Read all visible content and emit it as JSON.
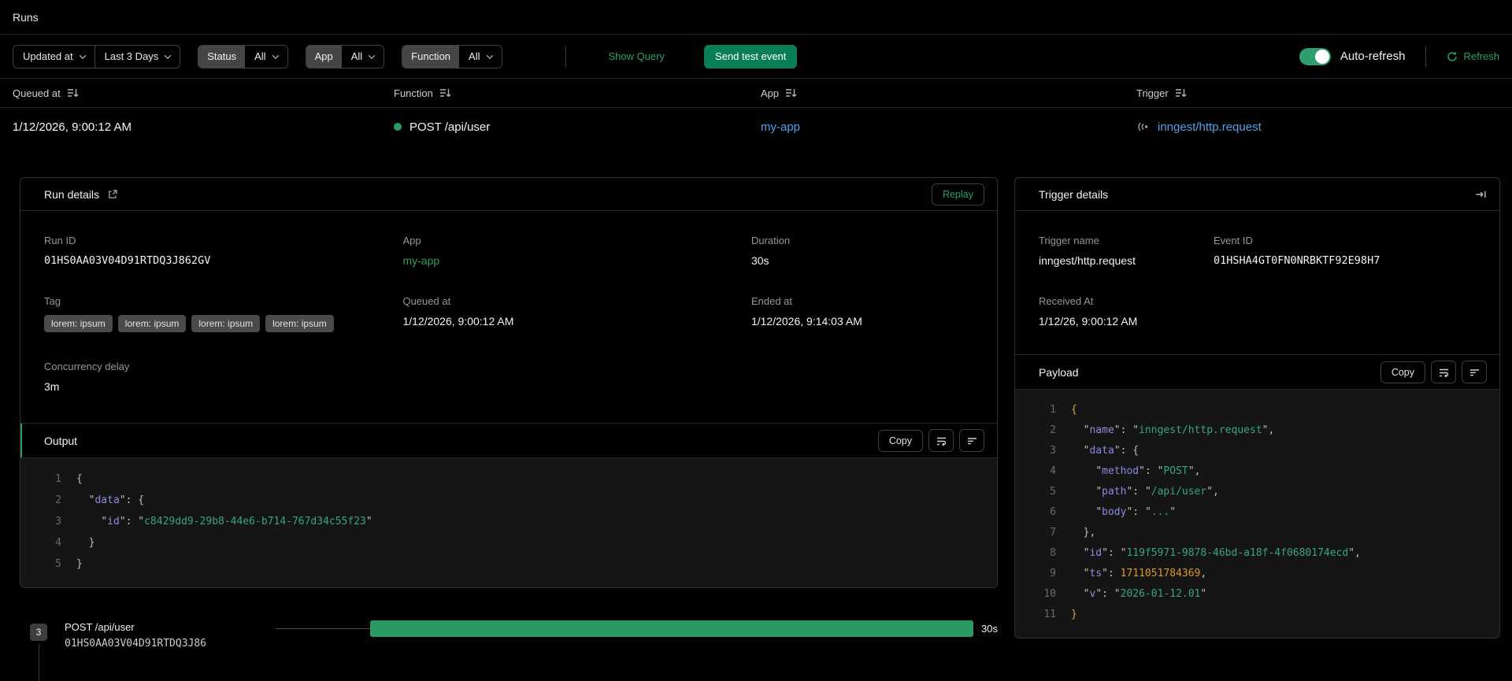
{
  "page": {
    "title": "Runs"
  },
  "colors": {
    "accent_green": "#2c9b63",
    "button_green": "#0a7e57",
    "link_blue": "#53a0e4"
  },
  "icons": [
    "sort-icon",
    "chevron-down-icon",
    "refresh-icon",
    "external-link-icon",
    "word-wrap-icon",
    "align-left-icon",
    "collapse-panel-icon",
    "webhook-icon",
    "status-dot"
  ],
  "filters": {
    "field_selector": {
      "value": "Updated at"
    },
    "range_selector": {
      "value": "Last 3 Days"
    },
    "status_filter": {
      "label": "Status",
      "value": "All"
    },
    "app_filter": {
      "label": "App",
      "value": "All"
    },
    "function_filter": {
      "label": "Function",
      "value": "All"
    },
    "show_query": "Show Query",
    "send_test_event": "Send test event",
    "auto_refresh": {
      "label": "Auto-refresh",
      "enabled": true
    },
    "refresh": "Refresh"
  },
  "table": {
    "headers": [
      {
        "label": "Queued at"
      },
      {
        "label": "Function"
      },
      {
        "label": "App"
      },
      {
        "label": "Trigger"
      }
    ],
    "row": {
      "queued_at": "1/12/2026, 9:00:12 AM",
      "function": "POST /api/user",
      "app": "my-app",
      "trigger": "inngest/http.request"
    }
  },
  "run_details": {
    "title": "Run details",
    "replay": "Replay",
    "run_id": {
      "label": "Run ID",
      "value": "01HS0AA03V04D91RTDQ3J862GV"
    },
    "app": {
      "label": "App",
      "value": "my-app"
    },
    "duration": {
      "label": "Duration",
      "value": "30s"
    },
    "tag": {
      "label": "Tag",
      "pills": [
        "lorem: ipsum",
        "lorem: ipsum",
        "lorem: ipsum",
        "lorem: ipsum"
      ]
    },
    "queued_at": {
      "label": "Queued at",
      "value": "1/12/2026, 9:00:12 AM"
    },
    "ended_at": {
      "label": "Ended at",
      "value": "1/12/2026, 9:14:03 AM"
    },
    "concurrency_delay": {
      "label": "Concurrency delay",
      "value": "3m"
    },
    "output": {
      "title": "Output",
      "copy": "Copy",
      "lines": [
        {
          "n": 1,
          "t": [
            [
              "{",
              "p"
            ]
          ]
        },
        {
          "n": 2,
          "t": [
            [
              "  ",
              "p"
            ],
            [
              "\"",
              "p"
            ],
            [
              "data",
              "k"
            ],
            [
              "\"",
              "p"
            ],
            [
              ": {",
              "p"
            ]
          ]
        },
        {
          "n": 3,
          "t": [
            [
              "    ",
              "p"
            ],
            [
              "\"",
              "p"
            ],
            [
              "id",
              "k"
            ],
            [
              "\"",
              "p"
            ],
            [
              ": ",
              "p"
            ],
            [
              "\"",
              "p"
            ],
            [
              "c8429dd9-29b8-44e6-b714-767d34c55f23",
              "s"
            ],
            [
              "\"",
              "p"
            ]
          ]
        },
        {
          "n": 4,
          "t": [
            [
              "  }",
              "p"
            ]
          ]
        },
        {
          "n": 5,
          "t": [
            [
              "}",
              "p"
            ]
          ]
        }
      ]
    }
  },
  "trigger_details": {
    "title": "Trigger details",
    "trigger_name": {
      "label": "Trigger name",
      "value": "inngest/http.request"
    },
    "event_id": {
      "label": "Event ID",
      "value": "01HSHA4GT0FN0NRBKTF92E98H7"
    },
    "received_at": {
      "label": "Received At",
      "value": "1/12/26, 9:00:12 AM"
    },
    "payload": {
      "title": "Payload",
      "copy": "Copy",
      "lines": [
        {
          "n": 1,
          "t": [
            [
              "{",
              "g"
            ]
          ]
        },
        {
          "n": 2,
          "t": [
            [
              "  ",
              "p"
            ],
            [
              "\"",
              "p"
            ],
            [
              "name",
              "k"
            ],
            [
              "\"",
              "p"
            ],
            [
              ": ",
              "p"
            ],
            [
              "\"",
              "p"
            ],
            [
              "inngest/http.request",
              "s"
            ],
            [
              "\"",
              "p"
            ],
            [
              ",",
              "p"
            ]
          ]
        },
        {
          "n": 3,
          "t": [
            [
              "  ",
              "p"
            ],
            [
              "\"",
              "p"
            ],
            [
              "data",
              "k"
            ],
            [
              "\"",
              "p"
            ],
            [
              ": {",
              "p"
            ]
          ]
        },
        {
          "n": 4,
          "t": [
            [
              "    ",
              "p"
            ],
            [
              "\"",
              "p"
            ],
            [
              "method",
              "k"
            ],
            [
              "\"",
              "p"
            ],
            [
              ": ",
              "p"
            ],
            [
              "\"",
              "p"
            ],
            [
              "POST",
              "s"
            ],
            [
              "\"",
              "p"
            ],
            [
              ",",
              "p"
            ]
          ]
        },
        {
          "n": 5,
          "t": [
            [
              "    ",
              "p"
            ],
            [
              "\"",
              "p"
            ],
            [
              "path",
              "k"
            ],
            [
              "\"",
              "p"
            ],
            [
              ": ",
              "p"
            ],
            [
              "\"",
              "p"
            ],
            [
              "/api/user",
              "s"
            ],
            [
              "\"",
              "p"
            ],
            [
              ",",
              "p"
            ]
          ]
        },
        {
          "n": 6,
          "t": [
            [
              "    ",
              "p"
            ],
            [
              "\"",
              "p"
            ],
            [
              "body",
              "k"
            ],
            [
              "\"",
              "p"
            ],
            [
              ": ",
              "p"
            ],
            [
              "\"",
              "p"
            ],
            [
              "...",
              "s"
            ],
            [
              "\"",
              "p"
            ]
          ]
        },
        {
          "n": 7,
          "t": [
            [
              "  },",
              "p"
            ]
          ]
        },
        {
          "n": 8,
          "t": [
            [
              "  ",
              "p"
            ],
            [
              "\"",
              "p"
            ],
            [
              "id",
              "k"
            ],
            [
              "\"",
              "p"
            ],
            [
              ": ",
              "p"
            ],
            [
              "\"",
              "p"
            ],
            [
              "119f5971-9878-46bd-a18f-4f0680174ecd",
              "s"
            ],
            [
              "\"",
              "p"
            ],
            [
              ",",
              "p"
            ]
          ]
        },
        {
          "n": 9,
          "t": [
            [
              "  ",
              "p"
            ],
            [
              "\"",
              "p"
            ],
            [
              "ts",
              "k"
            ],
            [
              "\"",
              "p"
            ],
            [
              ": ",
              "p"
            ],
            [
              "1711051784369",
              "n"
            ],
            [
              ",",
              "p"
            ]
          ]
        },
        {
          "n": 10,
          "t": [
            [
              "  ",
              "p"
            ],
            [
              "\"",
              "p"
            ],
            [
              "v",
              "k"
            ],
            [
              "\"",
              "p"
            ],
            [
              ": ",
              "p"
            ],
            [
              "\"",
              "p"
            ],
            [
              "2026-01-12.01",
              "s"
            ],
            [
              "\"",
              "p"
            ]
          ]
        },
        {
          "n": 11,
          "t": [
            [
              "}",
              "g"
            ]
          ]
        }
      ]
    }
  },
  "timeline": {
    "step_badge": "3",
    "function_name": "POST /api/user",
    "run_id": "01HS0AA03V04D91RTDQ3J86",
    "duration": "30s"
  }
}
